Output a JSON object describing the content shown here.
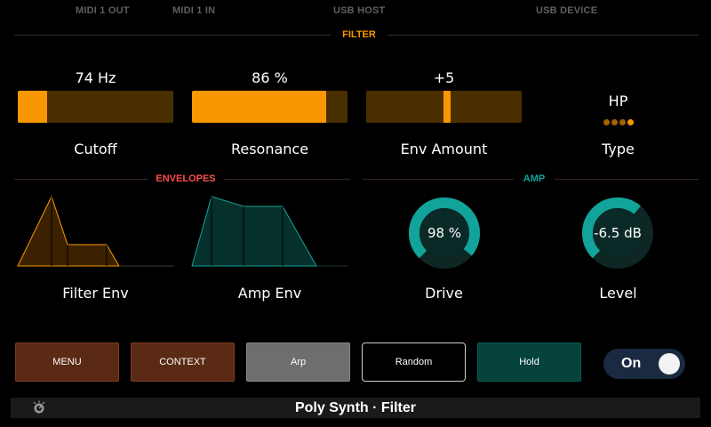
{
  "status_bar": {
    "midi_out": "MIDI 1 OUT",
    "midi_in": "MIDI 1 IN",
    "usb_host": "USB HOST",
    "usb_device": "USB DEVICE"
  },
  "sections": {
    "filter": "FILTER",
    "envelopes": "ENVELOPES",
    "amp": "AMP"
  },
  "colors": {
    "filter_accent": "#f99700",
    "envelopes_accent": "#ff4d4d",
    "amp_accent": "#12a39a",
    "menu_button": "#5a2a14",
    "hold_button": "#07433d",
    "arp_button": "#6e6e6e"
  },
  "filter": {
    "cutoff": {
      "value_text": "74 Hz",
      "label": "Cutoff",
      "level": 0.19
    },
    "resonance": {
      "value_text": "86 %",
      "label": "Resonance",
      "level": 0.86
    },
    "env_amount": {
      "value_text": "+5",
      "label": "Env Amount",
      "level": 0.52
    },
    "type": {
      "value_text": "HP",
      "label": "Type",
      "options_count": 4,
      "selected_index": 3
    }
  },
  "envelopes": {
    "filter_env": {
      "label": "Filter Env"
    },
    "amp_env": {
      "label": "Amp Env"
    }
  },
  "amp": {
    "drive": {
      "value_text": "98 %",
      "label": "Drive",
      "level": 0.98
    },
    "level": {
      "value_text": "-6.5 dB",
      "label": "Level",
      "level": 0.65
    }
  },
  "buttons": {
    "menu": "MENU",
    "context": "CONTEXT",
    "arp": "Arp",
    "random": "Random",
    "hold": "Hold"
  },
  "toggle": {
    "label": "On",
    "state": "on"
  },
  "bottom_bar": {
    "title": "Poly Synth  ·  Filter",
    "icon": "cpu-dial-icon"
  }
}
